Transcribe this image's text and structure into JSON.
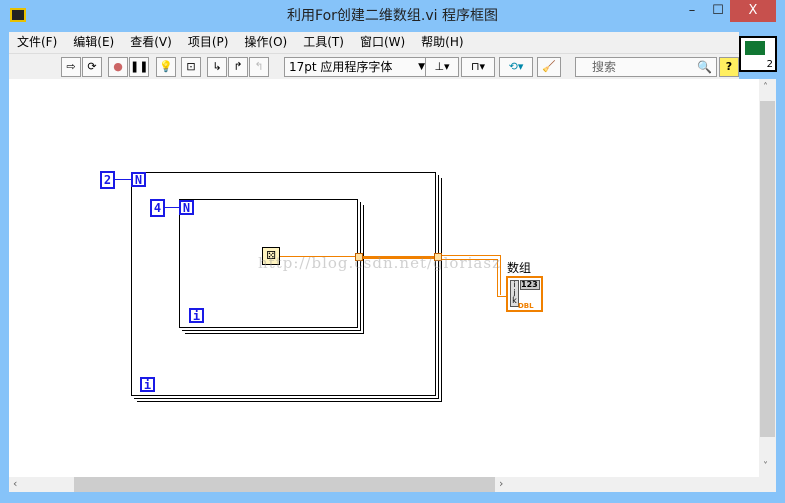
{
  "window": {
    "title": "利用For创建二维数组.vi 程序框图",
    "minimize": "–",
    "maximize": "☐",
    "close": "X"
  },
  "menu": [
    "文件(F)",
    "编辑(E)",
    "查看(V)",
    "项目(P)",
    "操作(O)",
    "工具(T)",
    "窗口(W)",
    "帮助(H)"
  ],
  "toolbar": {
    "font": "17pt 应用程序字体",
    "search_placeholder": "搜索",
    "help": "?"
  },
  "vi_icon_number": "2",
  "diagram": {
    "outer_count": "2",
    "outer_N": "N",
    "outer_i": "i",
    "inner_count": "4",
    "inner_N": "N",
    "inner_i": "i",
    "indicator_label": "数组",
    "indicator_index": [
      "i",
      "j",
      "k"
    ],
    "indicator_value": "123",
    "indicator_type": "DBL",
    "watermark": "http://blog.csdn.net/gloriasz",
    "wire_color": "#f08000"
  }
}
